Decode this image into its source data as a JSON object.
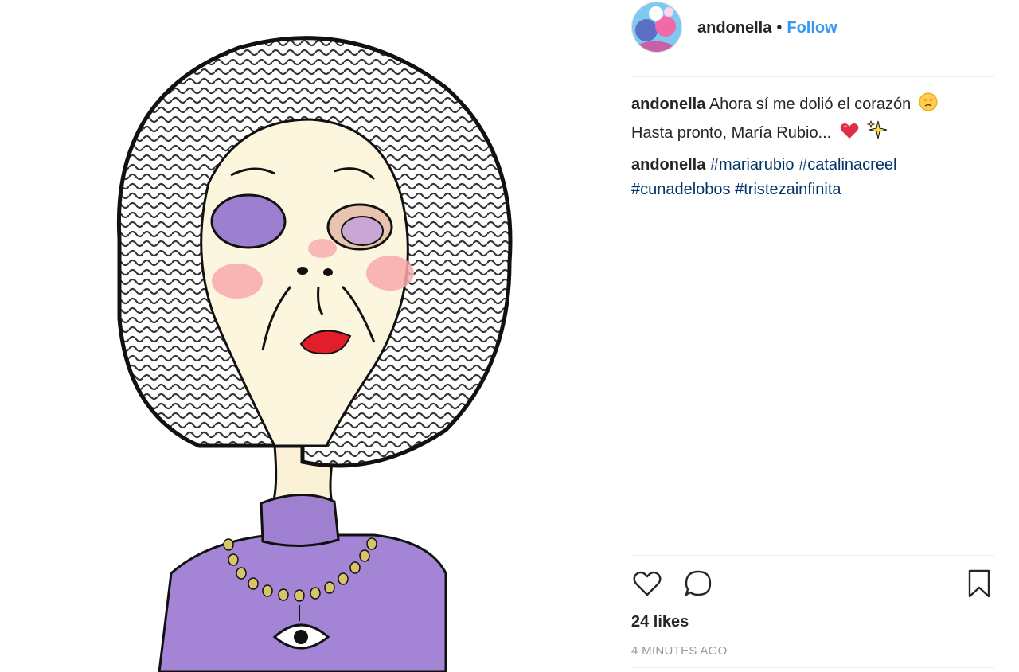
{
  "post": {
    "author": "andonella",
    "separator": "•",
    "follow_label": "Follow",
    "image_icon": "caricature-illustration"
  },
  "comments": [
    {
      "author": "andonella",
      "text_line1": "Ahora sí me dolió el corazón",
      "text_line2": "Hasta pronto, María Rubio...",
      "emojis": [
        "disappointed-face-emoji",
        "heart-emoji",
        "sparkles-emoji"
      ]
    },
    {
      "author": "andonella",
      "hashtags": [
        "#mariarubio",
        "#catalinacreel",
        "#cunadelobos",
        "#tristezainfinita"
      ]
    }
  ],
  "actions": {
    "like_icon": "heart-icon",
    "comment_icon": "comment-icon",
    "save_icon": "bookmark-icon"
  },
  "likes": "24 likes",
  "timestamp": "4 MINUTES AGO",
  "colors": {
    "link": "#3897f0",
    "hashtag": "#003569",
    "muted": "#999999",
    "divider": "#efefef"
  }
}
